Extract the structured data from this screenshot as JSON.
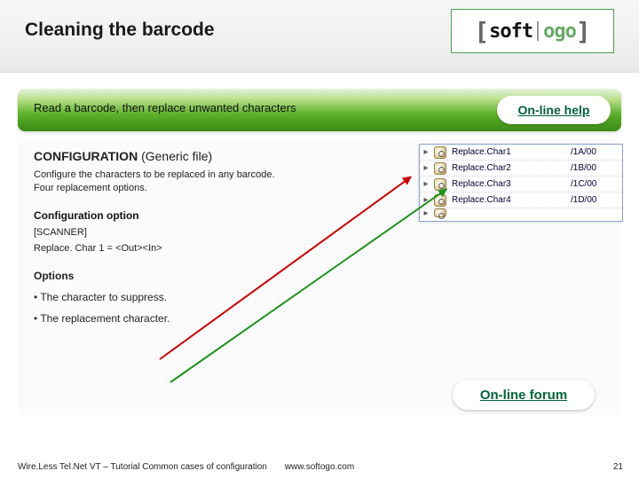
{
  "header": {
    "title": "Cleaning the barcode",
    "logo_seg1": "soft",
    "logo_seg2": "ogo"
  },
  "greenbar": {
    "lead": "Read a barcode, then replace unwanted characters",
    "help_label": "On-line help"
  },
  "panel": {
    "cfg_head_bold": "CONFIGURATION",
    "cfg_head_rest": " (Generic file)",
    "desc_line1": "Configure the characters to be replaced in any barcode.",
    "desc_line2": "Four replacement options.",
    "subhead": "Configuration option",
    "section": "[SCANNER]",
    "example": "Replace. Char 1 = <Out><In>",
    "options_head": "Options",
    "bullet1": "The character to suppress.",
    "bullet2": "The replacement character.",
    "forum_label": "On-line forum"
  },
  "snippet": {
    "rows": [
      {
        "name": "Replace.Char1",
        "val": "/1A/00"
      },
      {
        "name": "Replace.Char2",
        "val": "/1B/00"
      },
      {
        "name": "Replace.Char3",
        "val": "/1C/00"
      },
      {
        "name": "Replace.Char4",
        "val": "/1D/00"
      }
    ]
  },
  "footer": {
    "left": "Wire.Less Tel.Net VT – Tutorial Common cases of configuration",
    "center": "www.softogo.com",
    "page": "21"
  }
}
